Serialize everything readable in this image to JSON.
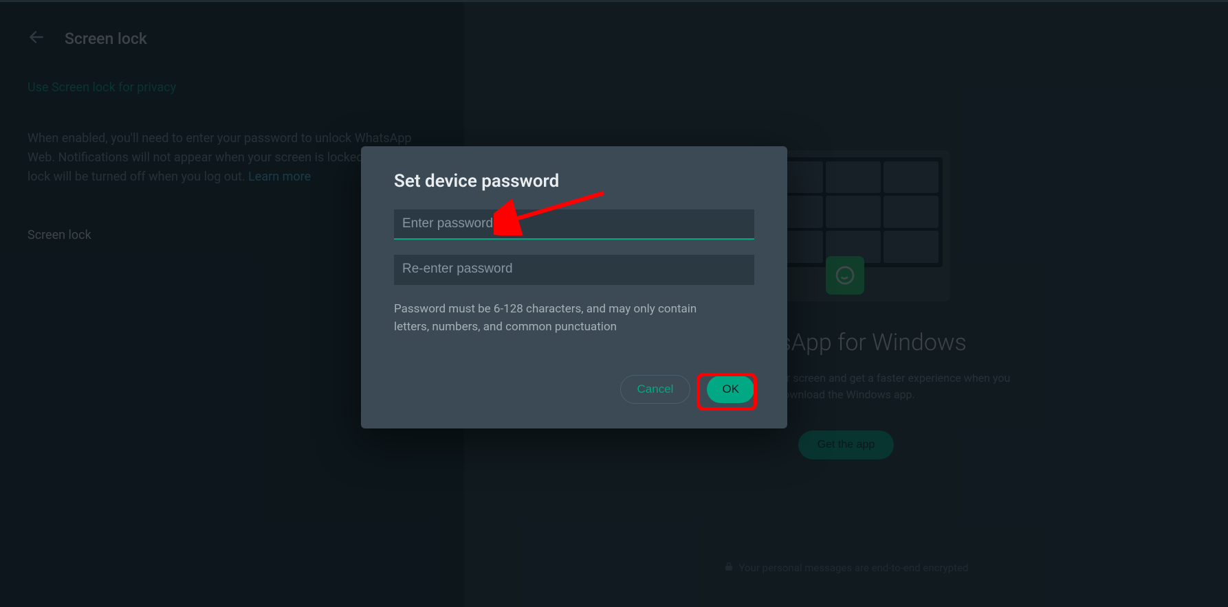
{
  "settings": {
    "page_title": "Screen lock",
    "section_link": "Use Screen lock for privacy",
    "description": "When enabled, you'll need to enter your password to unlock WhatsApp Web. Notifications will not appear when your screen is locked. Screen lock will be turned off when you log out. ",
    "learn_more": "Learn more",
    "row_label": "Screen lock"
  },
  "dialog": {
    "title": "Set device password",
    "password_placeholder": "Enter password",
    "reenter_placeholder": "Re-enter password",
    "help_text": "Password must be 6-128 characters, and may only contain letters, numbers, and common punctuation",
    "cancel_label": "Cancel",
    "ok_label": "OK"
  },
  "promo": {
    "title": "WhatsApp for Windows",
    "subtitle": "Make calls, share your screen and get a faster experience when you download the Windows app.",
    "button": "Get the app",
    "footer": "Your personal messages are end-to-end encrypted"
  }
}
